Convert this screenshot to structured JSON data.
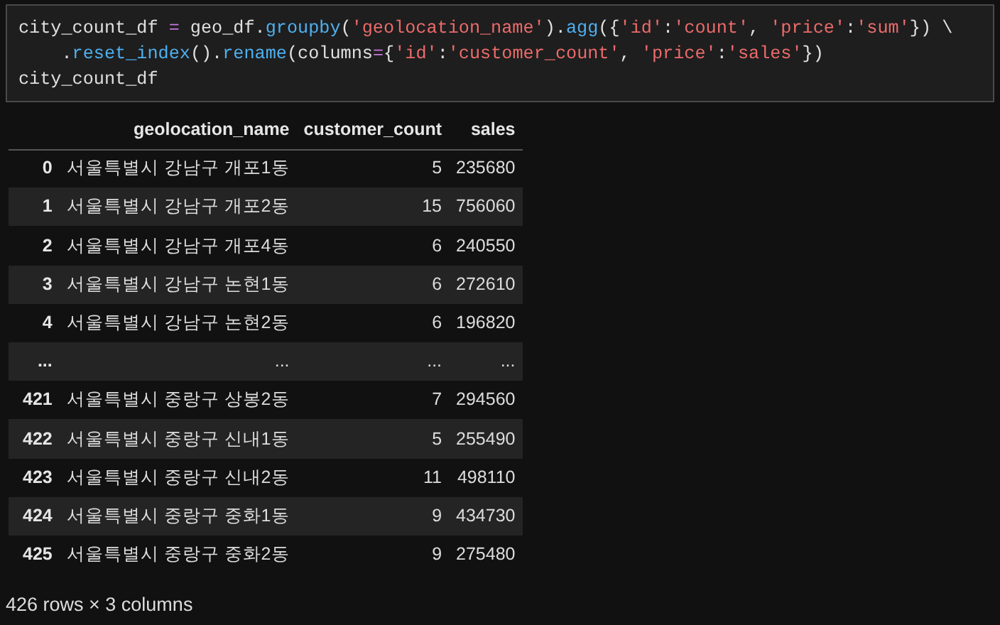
{
  "code_cell": {
    "lines": [
      [
        {
          "kind": "plain",
          "text": "city_count_df "
        },
        {
          "kind": "operator",
          "text": "="
        },
        {
          "kind": "plain",
          "text": " geo_df."
        },
        {
          "kind": "function",
          "text": "groupby"
        },
        {
          "kind": "plain",
          "text": "("
        },
        {
          "kind": "string",
          "text": "'geolocation_name'"
        },
        {
          "kind": "plain",
          "text": ")."
        },
        {
          "kind": "function",
          "text": "agg"
        },
        {
          "kind": "plain",
          "text": "({"
        },
        {
          "kind": "string",
          "text": "'id'"
        },
        {
          "kind": "plain",
          "text": ":"
        },
        {
          "kind": "string",
          "text": "'count'"
        },
        {
          "kind": "plain",
          "text": ", "
        },
        {
          "kind": "string",
          "text": "'price'"
        },
        {
          "kind": "plain",
          "text": ":"
        },
        {
          "kind": "string",
          "text": "'sum'"
        },
        {
          "kind": "plain",
          "text": "}) \\"
        }
      ],
      [
        {
          "kind": "plain",
          "text": "    ."
        },
        {
          "kind": "function",
          "text": "reset_index"
        },
        {
          "kind": "plain",
          "text": "()."
        },
        {
          "kind": "function",
          "text": "rename"
        },
        {
          "kind": "plain",
          "text": "(columns"
        },
        {
          "kind": "operator",
          "text": "="
        },
        {
          "kind": "plain",
          "text": "{"
        },
        {
          "kind": "string",
          "text": "'id'"
        },
        {
          "kind": "plain",
          "text": ":"
        },
        {
          "kind": "string",
          "text": "'customer_count'"
        },
        {
          "kind": "plain",
          "text": ", "
        },
        {
          "kind": "string",
          "text": "'price'"
        },
        {
          "kind": "plain",
          "text": ":"
        },
        {
          "kind": "string",
          "text": "'sales'"
        },
        {
          "kind": "plain",
          "text": "})"
        }
      ],
      [
        {
          "kind": "plain",
          "text": "city_count_df"
        }
      ]
    ]
  },
  "dataframe": {
    "columns": [
      "geolocation_name",
      "customer_count",
      "sales"
    ],
    "rows": [
      {
        "index": "0",
        "cells": [
          "서울특별시 강남구 개포1동",
          "5",
          "235680"
        ]
      },
      {
        "index": "1",
        "cells": [
          "서울특별시 강남구 개포2동",
          "15",
          "756060"
        ]
      },
      {
        "index": "2",
        "cells": [
          "서울특별시 강남구 개포4동",
          "6",
          "240550"
        ]
      },
      {
        "index": "3",
        "cells": [
          "서울특별시 강남구 논현1동",
          "6",
          "272610"
        ]
      },
      {
        "index": "4",
        "cells": [
          "서울특별시 강남구 논현2동",
          "6",
          "196820"
        ]
      },
      {
        "index": "...",
        "cells": [
          "...",
          "...",
          "..."
        ]
      },
      {
        "index": "421",
        "cells": [
          "서울특별시 중랑구 상봉2동",
          "7",
          "294560"
        ]
      },
      {
        "index": "422",
        "cells": [
          "서울특별시 중랑구 신내1동",
          "5",
          "255490"
        ]
      },
      {
        "index": "423",
        "cells": [
          "서울특별시 중랑구 신내2동",
          "11",
          "498110"
        ]
      },
      {
        "index": "424",
        "cells": [
          "서울특별시 중랑구 중화1동",
          "9",
          "434730"
        ]
      },
      {
        "index": "425",
        "cells": [
          "서울특별시 중랑구 중화2동",
          "9",
          "275480"
        ]
      }
    ],
    "shape_text": "426 rows × 3 columns"
  }
}
